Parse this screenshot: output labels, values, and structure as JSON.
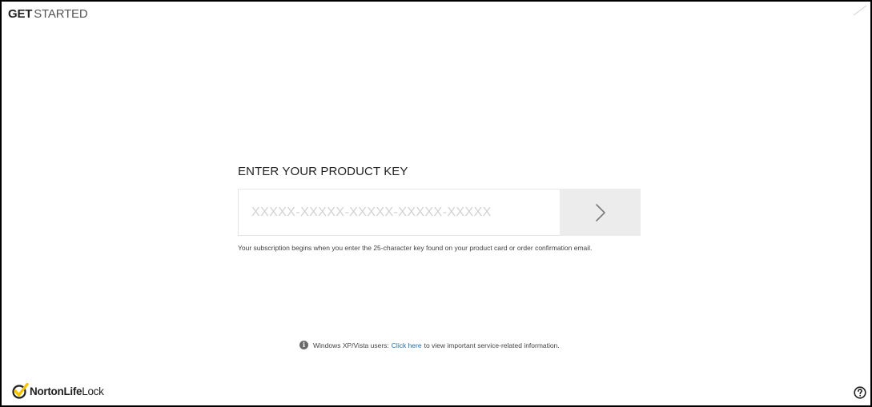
{
  "window": {
    "title_bold": "GET",
    "title_light": "STARTED"
  },
  "product_key": {
    "heading": "ENTER YOUR PRODUCT KEY",
    "placeholder": "XXXXX-XXXXX-XXXXX-XXXXX-XXXXX",
    "value": "",
    "submit_icon": "chevron-right-icon",
    "hint": "Your subscription begins when you enter the 25-character key found on your product card or order confirmation email."
  },
  "notice": {
    "icon": "info-icon",
    "icon_glyph": "i",
    "prefix": "Windows XP/Vista users:",
    "link_label": "Click here",
    "suffix": "to view important service-related information."
  },
  "brand": {
    "logo_icon": "norton-checkmark-icon",
    "name_main": "NortonLife",
    "name_tail": "Lock",
    "accent_color": "#f7c400"
  },
  "footer": {
    "help_icon": "help-question-icon"
  }
}
